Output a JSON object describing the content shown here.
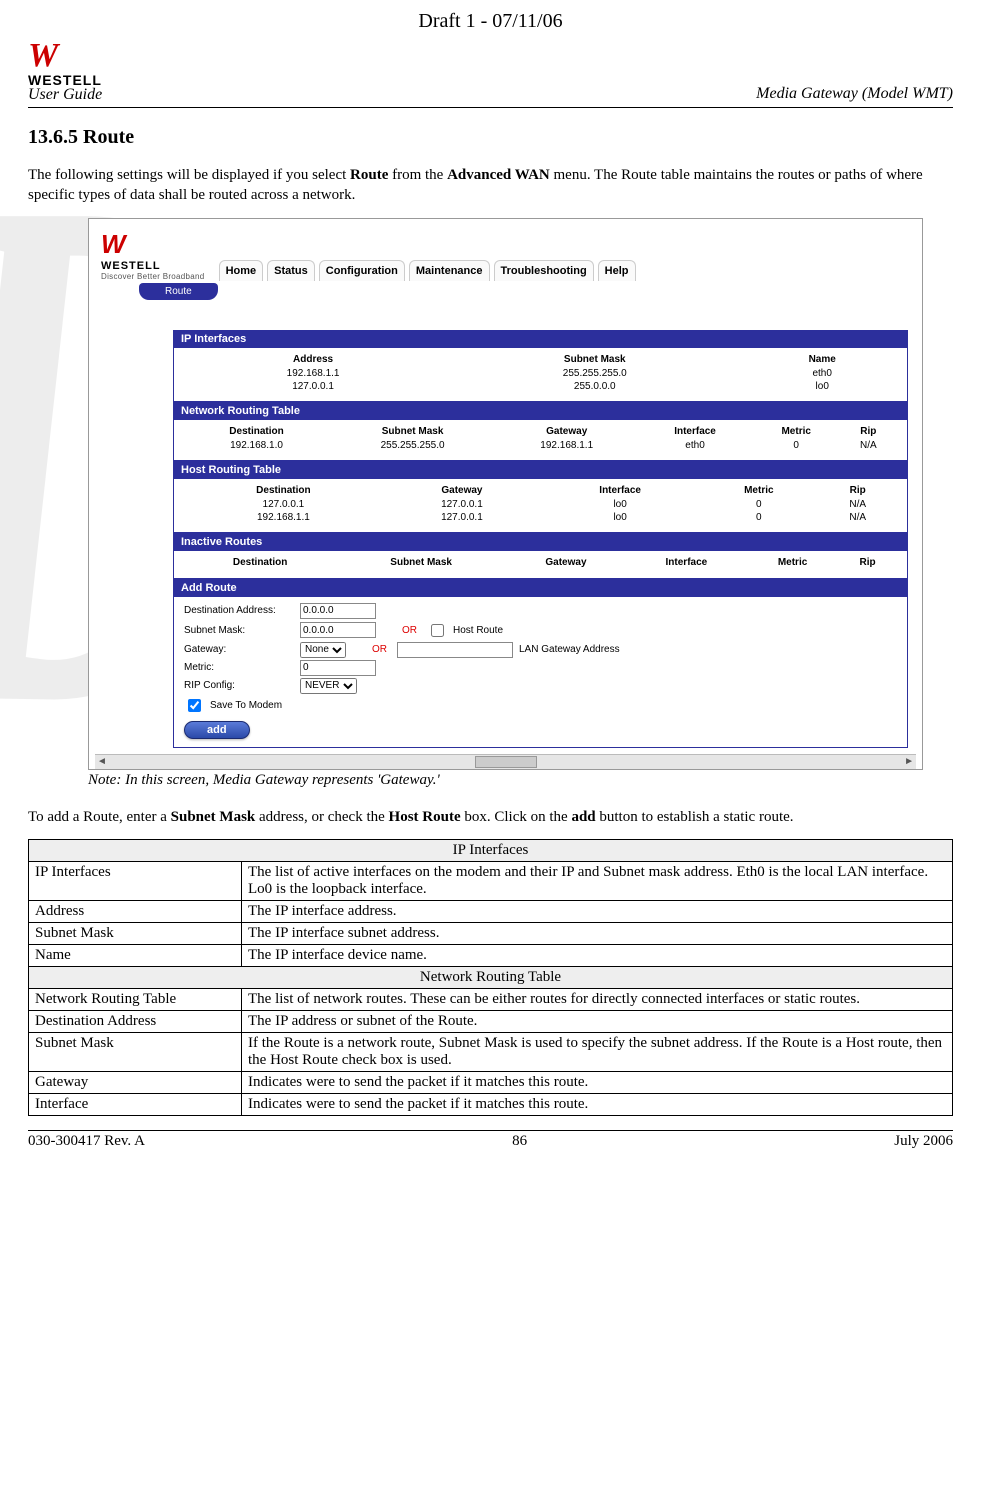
{
  "draft_header": "Draft 1 - 07/11/06",
  "brand": {
    "mark": "W",
    "name": "WESTELL",
    "tagline": "Discover Better Broadband"
  },
  "hdr": {
    "left": "User Guide",
    "right": "Media Gateway (Model WMT)"
  },
  "section": {
    "num_title": "13.6.5   Route"
  },
  "intro": {
    "p1a": "The following settings will be displayed if you select ",
    "p1b": "Route",
    "p1c": " from the ",
    "p1d": "Advanced WAN",
    "p1e": " menu. The Route table maintains the routes or paths of where specific types of data shall be routed across a network."
  },
  "nav": [
    "Home",
    "Status",
    "Configuration",
    "Maintenance",
    "Troubleshooting",
    "Help"
  ],
  "sub_tab": "Route",
  "panels": {
    "ip": {
      "title": "IP Interfaces",
      "cols": [
        "Address",
        "Subnet Mask",
        "Name"
      ],
      "rows": [
        [
          "192.168.1.1",
          "255.255.255.0",
          "eth0"
        ],
        [
          "127.0.0.1",
          "255.0.0.0",
          "lo0"
        ]
      ]
    },
    "net": {
      "title": "Network Routing Table",
      "cols": [
        "Destination",
        "Subnet Mask",
        "Gateway",
        "Interface",
        "Metric",
        "Rip"
      ],
      "rows": [
        [
          "192.168.1.0",
          "255.255.255.0",
          "192.168.1.1",
          "eth0",
          "0",
          "N/A"
        ]
      ]
    },
    "host": {
      "title": "Host Routing Table",
      "cols": [
        "Destination",
        "Gateway",
        "Interface",
        "Metric",
        "Rip"
      ],
      "rows": [
        [
          "127.0.0.1",
          "127.0.0.1",
          "lo0",
          "0",
          "N/A"
        ],
        [
          "192.168.1.1",
          "127.0.0.1",
          "lo0",
          "0",
          "N/A"
        ]
      ]
    },
    "inactive": {
      "title": "Inactive Routes",
      "cols": [
        "Destination",
        "Subnet Mask",
        "Gateway",
        "Interface",
        "Metric",
        "Rip"
      ]
    },
    "add": {
      "title": "Add Route",
      "labels": {
        "dest": "Destination Address:",
        "mask": "Subnet Mask:",
        "gw": "Gateway:",
        "metric": "Metric:",
        "rip": "RIP Config:",
        "save": "Save To Modem",
        "or": "OR",
        "hostroute": "Host Route",
        "langw": "LAN Gateway Address"
      },
      "values": {
        "dest": "0.0.0.0",
        "mask": "0.0.0.0",
        "gw": "None",
        "metric": "0",
        "rip": "NEVER"
      },
      "button": "add"
    }
  },
  "note": "Note: In this screen, Media Gateway represents 'Gateway.'",
  "para2": {
    "a": "To add a Route, enter a ",
    "b": "Subnet Mask",
    "c": " address, or check the ",
    "d": "Host Route",
    "e": " box. Click on the ",
    "f": "add",
    "g": " button to establish a static route."
  },
  "desc_table": {
    "s1": "IP Interfaces",
    "r1": [
      "IP Interfaces",
      "The list of active interfaces on the modem and their IP and Subnet mask address. Eth0 is the local LAN interface.\nLo0 is the loopback interface."
    ],
    "r2": [
      "Address",
      "The IP interface address."
    ],
    "r3": [
      "Subnet Mask",
      "The IP interface subnet address."
    ],
    "r4": [
      "Name",
      "The IP interface device name."
    ],
    "s2": "Network Routing Table",
    "r5": [
      "Network Routing Table",
      "The list of network routes. These can be either routes for directly connected interfaces or static routes."
    ],
    "r6": [
      "Destination Address",
      "The IP address or subnet of the Route."
    ],
    "r7": [
      "Subnet Mask",
      "If the Route is a network route, Subnet Mask is used to specify the subnet address. If the Route is a Host route, then the Host Route check box is used."
    ],
    "r8": [
      "Gateway",
      "Indicates were to send the packet if it matches this route."
    ],
    "r9": [
      "Interface",
      "Indicates were to send the packet if it matches this route."
    ]
  },
  "footer": {
    "left": "030-300417 Rev. A",
    "center": "86",
    "right": "July 2006"
  }
}
